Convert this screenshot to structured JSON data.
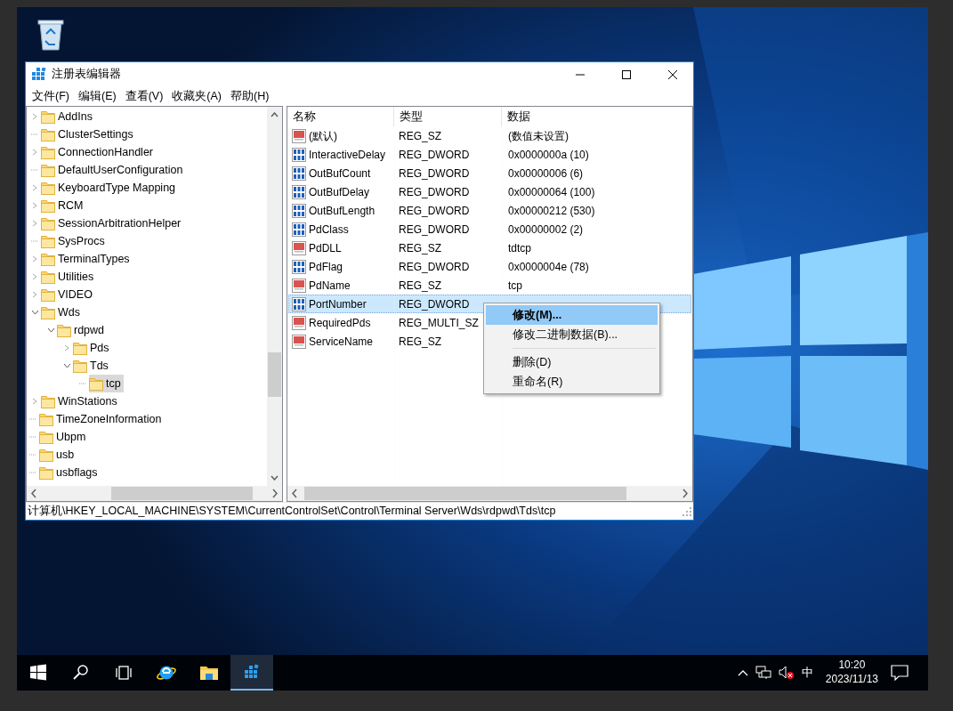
{
  "window": {
    "title": "注册表编辑器"
  },
  "menu": [
    "文件(F)",
    "编辑(E)",
    "查看(V)",
    "收藏夹(A)",
    "帮助(H)"
  ],
  "tree": {
    "items": [
      {
        "children": [
          {
            "label": "AddIns",
            "kind": "branch",
            "expanded": false,
            "selected": false
          },
          {
            "label": "ClusterSettings",
            "kind": "leaf",
            "selected": false
          },
          {
            "label": "ConnectionHandler",
            "kind": "branch",
            "expanded": false,
            "selected": false
          },
          {
            "label": "DefaultUserConfiguration",
            "kind": "leaf",
            "selected": false
          },
          {
            "label": "KeyboardType Mapping",
            "kind": "branch",
            "expanded": false,
            "selected": false
          },
          {
            "label": "RCM",
            "kind": "branch",
            "expanded": false,
            "selected": false
          },
          {
            "label": "SessionArbitrationHelper",
            "kind": "branch",
            "expanded": false,
            "selected": false
          },
          {
            "label": "SysProcs",
            "kind": "leaf",
            "selected": false
          },
          {
            "label": "TerminalTypes",
            "kind": "branch",
            "expanded": false,
            "selected": false
          },
          {
            "label": "Utilities",
            "kind": "branch",
            "expanded": false,
            "selected": false
          },
          {
            "label": "VIDEO",
            "kind": "branch",
            "expanded": false,
            "selected": false
          },
          {
            "label": "Wds",
            "kind": "branch",
            "expanded": true,
            "selected": false,
            "children": [
              {
                "label": "rdpwd",
                "kind": "branch",
                "expanded": true,
                "selected": false,
                "children": [
                  {
                    "label": "Pds",
                    "kind": "branch",
                    "expanded": false,
                    "selected": false
                  },
                  {
                    "label": "Tds",
                    "kind": "branch",
                    "expanded": true,
                    "selected": false,
                    "children": [
                      {
                        "label": "tcp",
                        "kind": "leaf",
                        "selected": true
                      }
                    ]
                  }
                ]
              }
            ]
          },
          {
            "label": "WinStations",
            "kind": "branch",
            "expanded": false,
            "selected": false
          }
        ]
      },
      {
        "label": "TimeZoneInformation",
        "kind": "leaf",
        "selected": false
      },
      {
        "label": "Ubpm",
        "kind": "leaf",
        "selected": false
      },
      {
        "label": "usb",
        "kind": "leaf",
        "selected": false
      },
      {
        "label": "usbflags",
        "kind": "leaf",
        "selected": false
      }
    ]
  },
  "values": {
    "columns": [
      "名称",
      "类型",
      "数据"
    ],
    "rows": [
      {
        "kind": "string",
        "name": "(默认)",
        "type": "REG_SZ",
        "data": "(数值未设置)",
        "selected": false
      },
      {
        "kind": "binary",
        "name": "InteractiveDelay",
        "type": "REG_DWORD",
        "data": "0x0000000a (10)",
        "selected": false
      },
      {
        "kind": "binary",
        "name": "OutBufCount",
        "type": "REG_DWORD",
        "data": "0x00000006 (6)",
        "selected": false
      },
      {
        "kind": "binary",
        "name": "OutBufDelay",
        "type": "REG_DWORD",
        "data": "0x00000064 (100)",
        "selected": false
      },
      {
        "kind": "binary",
        "name": "OutBufLength",
        "type": "REG_DWORD",
        "data": "0x00000212 (530)",
        "selected": false
      },
      {
        "kind": "binary",
        "name": "PdClass",
        "type": "REG_DWORD",
        "data": "0x00000002 (2)",
        "selected": false
      },
      {
        "kind": "string",
        "name": "PdDLL",
        "type": "REG_SZ",
        "data": "tdtcp",
        "selected": false
      },
      {
        "kind": "binary",
        "name": "PdFlag",
        "type": "REG_DWORD",
        "data": "0x0000004e (78)",
        "selected": false
      },
      {
        "kind": "string",
        "name": "PdName",
        "type": "REG_SZ",
        "data": "tcp",
        "selected": false
      },
      {
        "kind": "binary",
        "name": "PortNumber",
        "type": "REG_DWORD",
        "selected": true
      },
      {
        "kind": "string",
        "name": "RequiredPds",
        "type": "REG_MULTI_SZ",
        "selected": false
      },
      {
        "kind": "string",
        "name": "ServiceName",
        "type": "REG_SZ",
        "selected": false
      }
    ]
  },
  "context_menu": [
    {
      "kind": "item",
      "label": "修改(M)...",
      "selected": true
    },
    {
      "kind": "item",
      "label": "修改二进制数据(B)...",
      "selected": false
    },
    {
      "kind": "separator"
    },
    {
      "kind": "item",
      "label": "删除(D)",
      "selected": false
    },
    {
      "kind": "item",
      "label": "重命名(R)",
      "selected": false
    }
  ],
  "status_bar": "计算机\\HKEY_LOCAL_MACHINE\\SYSTEM\\CurrentControlSet\\Control\\Terminal Server\\Wds\\rdpwd\\Tds\\tcp",
  "taskbar": {
    "apps": [
      {
        "kind": "ie",
        "selected": false
      },
      {
        "kind": "explorer",
        "selected": false
      },
      {
        "kind": "regedit",
        "selected": true
      }
    ],
    "tray": {
      "ime": "中",
      "time": "10:20",
      "date": "2023/11/13"
    }
  }
}
